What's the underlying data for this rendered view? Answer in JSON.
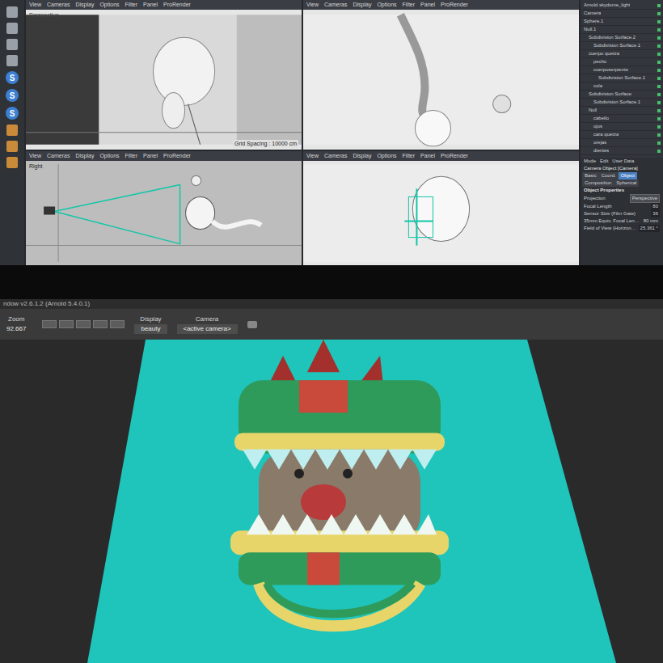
{
  "monitor": {
    "tools": [
      {
        "glyph": "S"
      },
      {
        "glyph": "S"
      },
      {
        "glyph": "S"
      }
    ],
    "viewports": [
      {
        "kind": "perspective",
        "menu": [
          "View",
          "Cameras",
          "Display",
          "Options",
          "Filter",
          "Panel",
          "ProRender"
        ],
        "label": "Perspective",
        "footer": "Grid Spacing : 10000 cm"
      },
      {
        "kind": "top",
        "menu": [
          "View",
          "Cameras",
          "Display",
          "Options",
          "Filter",
          "Panel",
          "ProRender"
        ]
      },
      {
        "kind": "right",
        "menu": [
          "View",
          "Cameras",
          "Display",
          "Options",
          "Filter",
          "Panel",
          "ProRender"
        ],
        "label": "Right"
      },
      {
        "kind": "front",
        "menu": [
          "View",
          "Cameras",
          "Display",
          "Options",
          "Filter",
          "Panel",
          "ProRender"
        ]
      }
    ],
    "objects": [
      {
        "name": "Arnold skydome_light",
        "depth": 0
      },
      {
        "name": "Camera",
        "depth": 0
      },
      {
        "name": "Sphere.1",
        "depth": 0
      },
      {
        "name": "Null.1",
        "depth": 0
      },
      {
        "name": "Subdivision Surface.2",
        "depth": 1
      },
      {
        "name": "Subdivision Surface.1",
        "depth": 2
      },
      {
        "name": "cuerpo quetza",
        "depth": 1
      },
      {
        "name": "pecho",
        "depth": 2
      },
      {
        "name": "cuerposerpiente",
        "depth": 2
      },
      {
        "name": "Subdivision Surface.1",
        "depth": 3
      },
      {
        "name": "cola",
        "depth": 2
      },
      {
        "name": "Subdivision Surface",
        "depth": 1
      },
      {
        "name": "Subdivision Surface.1",
        "depth": 2
      },
      {
        "name": "Null",
        "depth": 1
      },
      {
        "name": "cabello",
        "depth": 2
      },
      {
        "name": "ojos",
        "depth": 2
      },
      {
        "name": "cara quetza",
        "depth": 2
      },
      {
        "name": "orejas",
        "depth": 2
      },
      {
        "name": "dientes",
        "depth": 2
      }
    ],
    "attributes": {
      "menu": [
        "Mode",
        "Edit",
        "User Data"
      ],
      "title": "Camera Object [Camera]",
      "tabs": [
        {
          "label": "Basic",
          "selected": false
        },
        {
          "label": "Coord.",
          "selected": false
        },
        {
          "label": "Object",
          "selected": true
        },
        {
          "label": "Composition",
          "selected": false
        },
        {
          "label": "Spherical",
          "selected": false
        }
      ],
      "section": "Object Properties",
      "rows": [
        {
          "label": "Projection",
          "value": "Perspective",
          "kind": "dropdown"
        },
        {
          "label": "Focal Length",
          "value": "80",
          "kind": "number"
        },
        {
          "label": "Sensor Size (Film Gate)",
          "value": "36",
          "kind": "number"
        },
        {
          "label": "35mm Equiv. Focal Length",
          "value": "80 mm",
          "kind": "text"
        },
        {
          "label": "Field of View (Horizontal)",
          "value": "25.361 °",
          "kind": "number"
        }
      ]
    }
  },
  "laptop": {
    "title": "ndow v2.6.1.2 (Arnold 5.4.0.1)",
    "zoom": {
      "label": "Zoom",
      "value": "92.667"
    },
    "display": {
      "label": "Display",
      "value": "beauty"
    },
    "camera": {
      "label": "Camera",
      "value": "<active camera>"
    }
  }
}
